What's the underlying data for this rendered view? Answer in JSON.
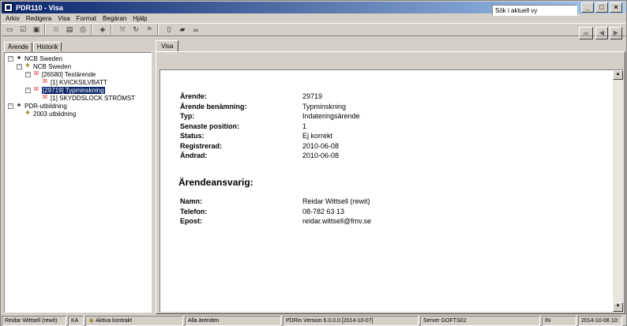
{
  "window": {
    "title": "PDR110 - Visa"
  },
  "menu": [
    "Arkiv",
    "Redigera",
    "Visa",
    "Format",
    "Begäran",
    "Hjälp"
  ],
  "toolbar": {
    "search_value": "Sök i aktuell vy"
  },
  "left_tabs": [
    "Ärende",
    "Historik"
  ],
  "tree": [
    {
      "label": "NCB Sweden",
      "level": 0,
      "expander": "−",
      "icon": "org"
    },
    {
      "label": "NCB Sweden",
      "level": 1,
      "expander": "−",
      "icon": "group"
    },
    {
      "label": "[26580] Testärende",
      "level": 2,
      "expander": "−",
      "icon": "case"
    },
    {
      "label": "[1] KVICKSILVBATT",
      "level": 3,
      "expander": "",
      "icon": "item"
    },
    {
      "label": "[29719] Typminskning",
      "level": 2,
      "expander": "−",
      "icon": "case",
      "selected": true
    },
    {
      "label": "[1] SKYDDSLOCK STRÖMST",
      "level": 3,
      "expander": "",
      "icon": "item"
    },
    {
      "label": "PDR-utbildning",
      "level": 0,
      "expander": "−",
      "icon": "org"
    },
    {
      "label": "2003 utbildning",
      "level": 1,
      "expander": "",
      "icon": "group"
    }
  ],
  "right_tab": "Visa",
  "details": {
    "fields": [
      {
        "label": "Ärende:",
        "value": "29719"
      },
      {
        "label": "Ärende benämning:",
        "value": "Typminskning"
      },
      {
        "label": "Typ:",
        "value": "Indateringsärende"
      },
      {
        "label": "Senaste position:",
        "value": "1"
      },
      {
        "label": "Status:",
        "value": "Ej korrekt"
      },
      {
        "label": "Registrerad:",
        "value": "2010-06-08"
      },
      {
        "label": "Ändrad:",
        "value": "2010-06-08"
      }
    ],
    "section_title": "Ärendeansvarig:",
    "contact": [
      {
        "label": "Namn:",
        "value": "Reidar Wittsell (rewit)"
      },
      {
        "label": "Telefon:",
        "value": "08-782 63 13"
      },
      {
        "label": "Epost:",
        "value": "reidar.wittsell@fmv.se"
      }
    ]
  },
  "status": {
    "user": "Reidar Wittsell (rewit)",
    "code": "KA",
    "contract": "Aktiva kontrakt",
    "filter": "Alla ärenden",
    "version": "PDRin Version 6.0.0.0 [2014-10-07]",
    "server": "Server GOFTS02",
    "mode": "IN",
    "datetime": "2014-10-08  10:"
  }
}
